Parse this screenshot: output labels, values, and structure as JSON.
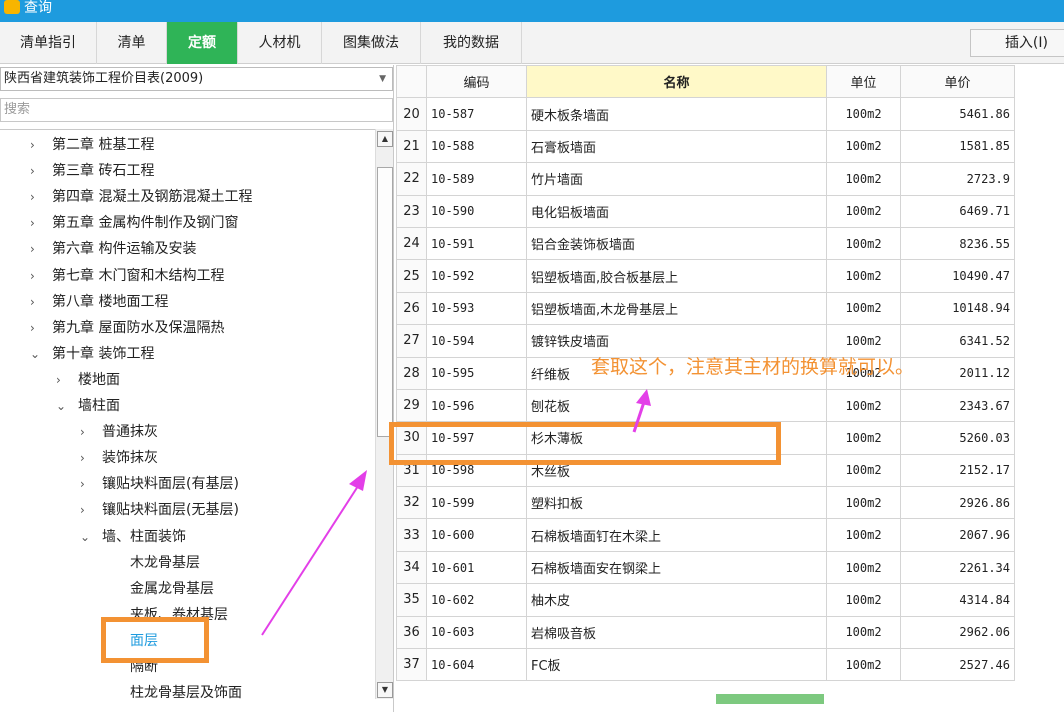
{
  "window": {
    "title": "查询"
  },
  "tabs": [
    {
      "label": "清单指引",
      "active": false
    },
    {
      "label": "清单",
      "active": false
    },
    {
      "label": "定额",
      "active": true
    },
    {
      "label": "人材机",
      "active": false
    },
    {
      "label": "图集做法",
      "active": false
    },
    {
      "label": "我的数据",
      "active": false
    }
  ],
  "insert_button": "插入(I)",
  "library_select": {
    "value": "陕西省建筑装饰工程价目表(2009)"
  },
  "search": {
    "placeholder": "搜索"
  },
  "tree": [
    {
      "label": "第二章 桩基工程",
      "level": 0,
      "state": "collapsed"
    },
    {
      "label": "第三章 砖石工程",
      "level": 0,
      "state": "collapsed"
    },
    {
      "label": "第四章 混凝土及钢筋混凝土工程",
      "level": 0,
      "state": "collapsed"
    },
    {
      "label": "第五章 金属构件制作及钢门窗",
      "level": 0,
      "state": "collapsed"
    },
    {
      "label": "第六章 构件运输及安装",
      "level": 0,
      "state": "collapsed"
    },
    {
      "label": "第七章 木门窗和木结构工程",
      "level": 0,
      "state": "collapsed"
    },
    {
      "label": "第八章 楼地面工程",
      "level": 0,
      "state": "collapsed"
    },
    {
      "label": "第九章 屋面防水及保温隔热",
      "level": 0,
      "state": "collapsed"
    },
    {
      "label": "第十章 装饰工程",
      "level": 0,
      "state": "expanded"
    },
    {
      "label": "楼地面",
      "level": 1,
      "state": "collapsed"
    },
    {
      "label": "墙柱面",
      "level": 1,
      "state": "expanded"
    },
    {
      "label": "普通抹灰",
      "level": 2,
      "state": "collapsed"
    },
    {
      "label": "装饰抹灰",
      "level": 2,
      "state": "collapsed"
    },
    {
      "label": "镶贴块料面层(有基层)",
      "level": 2,
      "state": "collapsed"
    },
    {
      "label": "镶贴块料面层(无基层)",
      "level": 2,
      "state": "collapsed"
    },
    {
      "label": "墙、柱面装饰",
      "level": 2,
      "state": "expanded"
    },
    {
      "label": "木龙骨基层",
      "level": 3,
      "state": "leaf"
    },
    {
      "label": "金属龙骨基层",
      "level": 3,
      "state": "leaf"
    },
    {
      "label": "夹板、卷材基层",
      "level": 3,
      "state": "leaf"
    },
    {
      "label": "面层",
      "level": 3,
      "state": "leaf",
      "selected": true
    },
    {
      "label": "隔断",
      "level": 3,
      "state": "leaf"
    },
    {
      "label": "柱龙骨基层及饰面",
      "level": 3,
      "state": "leaf"
    }
  ],
  "table": {
    "columns": [
      "",
      "编码",
      "名称",
      "单位",
      "单价"
    ],
    "rows": [
      [
        "20",
        "10-587",
        "硬木板条墙面",
        "100m2",
        "5461.86"
      ],
      [
        "21",
        "10-588",
        "石膏板墙面",
        "100m2",
        "1581.85"
      ],
      [
        "22",
        "10-589",
        "竹片墙面",
        "100m2",
        "2723.9"
      ],
      [
        "23",
        "10-590",
        "电化铝板墙面",
        "100m2",
        "6469.71"
      ],
      [
        "24",
        "10-591",
        "铝合金装饰板墙面",
        "100m2",
        "8236.55"
      ],
      [
        "25",
        "10-592",
        "铝塑板墙面,胶合板基层上",
        "100m2",
        "10490.47"
      ],
      [
        "26",
        "10-593",
        "铝塑板墙面,木龙骨基层上",
        "100m2",
        "10148.94"
      ],
      [
        "27",
        "10-594",
        "镀锌铁皮墙面",
        "100m2",
        "6341.52"
      ],
      [
        "28",
        "10-595",
        "纤维板",
        "100m2",
        "2011.12"
      ],
      [
        "29",
        "10-596",
        "刨花板",
        "100m2",
        "2343.67"
      ],
      [
        "30",
        "10-597",
        "杉木薄板",
        "100m2",
        "5260.03"
      ],
      [
        "31",
        "10-598",
        "木丝板",
        "100m2",
        "2152.17"
      ],
      [
        "32",
        "10-599",
        "塑料扣板",
        "100m2",
        "2926.86"
      ],
      [
        "33",
        "10-600",
        "石棉板墙面钉在木梁上",
        "100m2",
        "2067.96"
      ],
      [
        "34",
        "10-601",
        "石棉板墙面安在钢梁上",
        "100m2",
        "2261.34"
      ],
      [
        "35",
        "10-602",
        "柚木皮",
        "100m2",
        "4314.84"
      ],
      [
        "36",
        "10-603",
        "岩棉吸音板",
        "100m2",
        "2962.06"
      ],
      [
        "37",
        "10-604",
        "FC板",
        "100m2",
        "2527.46"
      ]
    ]
  },
  "annotation": {
    "text": "套取这个，注意其主材的换算就可以。",
    "color": "#f39233",
    "arrow_color": "#e33fe8"
  },
  "colors": {
    "titlebar": "#1e9bde",
    "active_tab": "#2fb457",
    "name_header": "#fff9c8",
    "selected_tree_item": "#1e9bde"
  }
}
